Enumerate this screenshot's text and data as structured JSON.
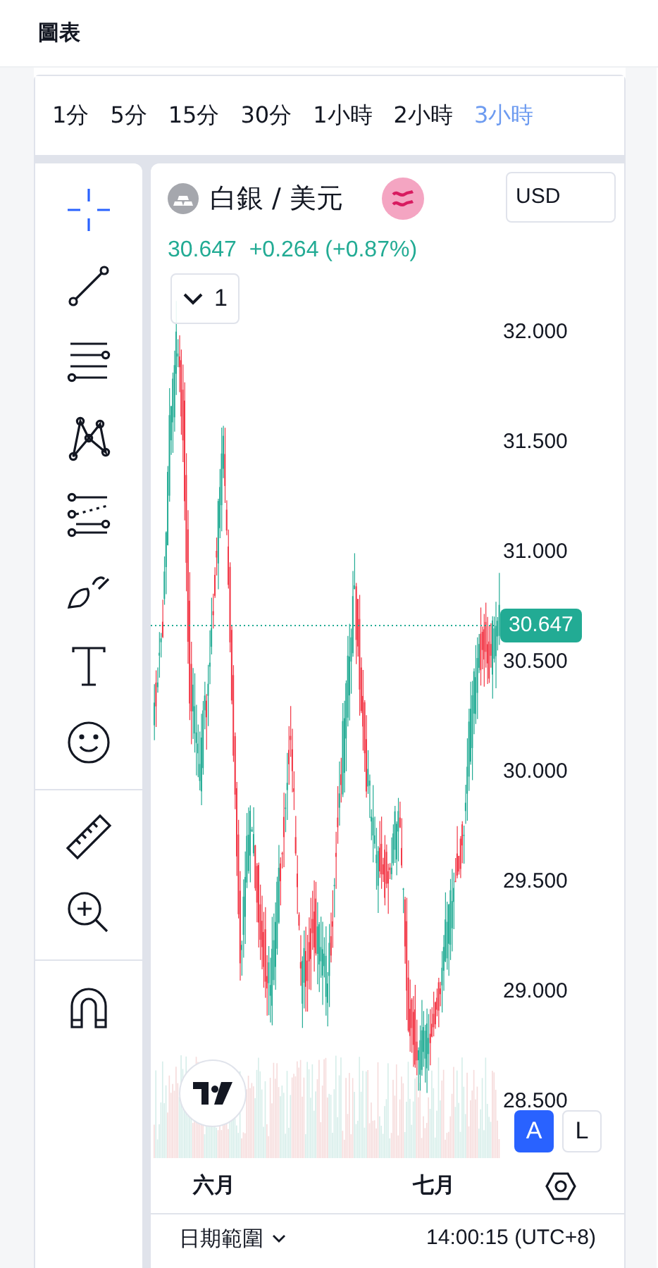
{
  "page_title": "圖表",
  "timeframes": [
    {
      "label": "1分",
      "selected": false
    },
    {
      "label": "5分",
      "selected": false
    },
    {
      "label": "15分",
      "selected": false
    },
    {
      "label": "30分",
      "selected": false
    },
    {
      "label": "1小時",
      "selected": false
    },
    {
      "label": "2小時",
      "selected": false
    },
    {
      "label": "3小時",
      "selected": true
    }
  ],
  "tool_groups": [
    [
      {
        "kind": "crosshair",
        "selected": true
      },
      {
        "kind": "trendline",
        "selected": false
      },
      {
        "kind": "lines",
        "selected": false
      },
      {
        "kind": "pattern",
        "selected": false
      },
      {
        "kind": "projection",
        "selected": false
      },
      {
        "kind": "brush",
        "selected": false
      },
      {
        "kind": "text",
        "selected": false
      },
      {
        "kind": "emoji",
        "selected": false
      }
    ],
    [
      {
        "kind": "ruler",
        "selected": false
      },
      {
        "kind": "zoom",
        "selected": false
      }
    ],
    [
      {
        "kind": "magnet",
        "selected": false
      }
    ]
  ],
  "symbol": {
    "name": "白銀 / 美元",
    "currency": "USD",
    "price": "30.647",
    "change": "+0.264 (+0.87%)",
    "collapse": "1"
  },
  "price_axis": [
    "32.000",
    "31.500",
    "31.000",
    "30.500",
    "30.000",
    "29.500",
    "29.000",
    "28.500"
  ],
  "last_price": "30.647",
  "scale_buttons": [
    {
      "label": "A",
      "selected": true
    },
    {
      "label": "L",
      "selected": false
    }
  ],
  "time_axis": [
    "六月",
    "七月"
  ],
  "footer": {
    "range": "日期範圍",
    "time": "14:00:15 (UTC+8)"
  }
}
